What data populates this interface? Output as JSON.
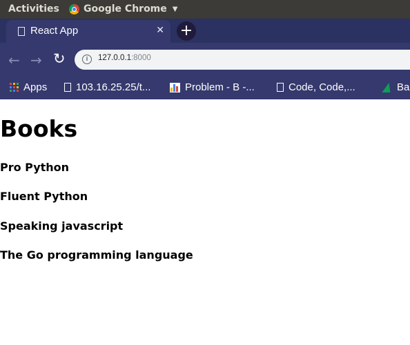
{
  "os_panel": {
    "activities_label": "Activities",
    "app_name": "Google Chrome",
    "app_icon": "chrome-icon",
    "dropdown_icon": "chevron-down-icon"
  },
  "browser": {
    "tab": {
      "title": "React App",
      "icon": "page-icon",
      "close_icon": "close-icon"
    },
    "new_tab_icon": "plus-icon",
    "toolbar": {
      "back_icon": "back-arrow-icon",
      "forward_icon": "forward-arrow-icon",
      "reload_icon": "reload-icon",
      "info_icon": "info-icon",
      "url_host": "127.0.0.1",
      "url_port": ":8000"
    },
    "bookmarks": [
      {
        "label": "Apps",
        "icon": "apps-grid-icon"
      },
      {
        "label": "103.16.25.25/t...",
        "icon": "page-icon"
      },
      {
        "label": "Problem - B -...",
        "icon": "chart-favicon-icon"
      },
      {
        "label": "Code, Code,...",
        "icon": "page-icon"
      },
      {
        "label": "Ba",
        "icon": "green-triangle-icon"
      }
    ],
    "colors": {
      "tab_strip": "#2b3160",
      "toolbar": "#35396d",
      "os_panel": "#3c3b37"
    }
  },
  "page": {
    "heading": "Books",
    "books": [
      "Pro Python",
      "Fluent Python",
      "Speaking javascript",
      "The Go programming language"
    ]
  }
}
